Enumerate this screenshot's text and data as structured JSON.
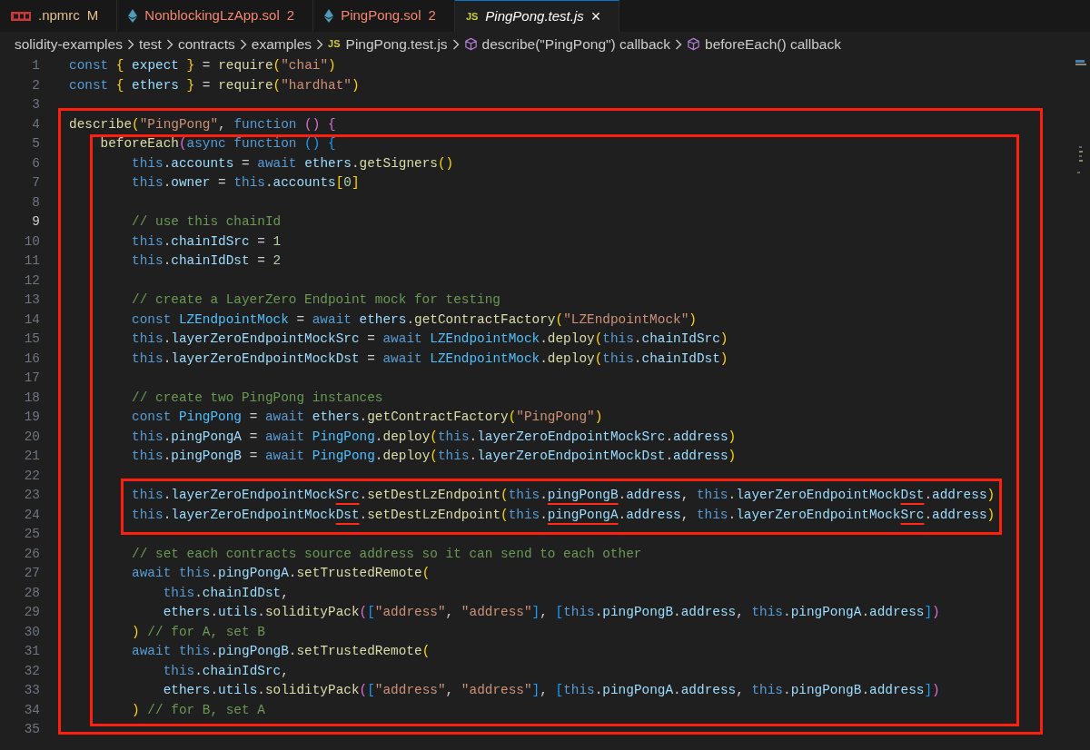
{
  "tabs": [
    {
      "label": ".npmrc",
      "badge": "M",
      "kind": "npm",
      "color": "#e2c08d",
      "selected": false,
      "preview": false
    },
    {
      "label": "NonblockingLzApp.sol",
      "badge": "2",
      "kind": "solidity",
      "color": "#f48771",
      "selected": false,
      "preview": false
    },
    {
      "label": "PingPong.sol",
      "badge": "2",
      "kind": "solidity",
      "color": "#f48771",
      "selected": false,
      "preview": false
    },
    {
      "label": "PingPong.test.js",
      "kind": "javascript",
      "icon_text": "JS",
      "color": "#ffffff",
      "selected": true,
      "preview": true,
      "close": "×"
    }
  ],
  "breadcrumb": [
    {
      "label": "solidity-examples",
      "kind": "folder"
    },
    {
      "label": "test",
      "kind": "folder"
    },
    {
      "label": "contracts",
      "kind": "folder"
    },
    {
      "label": "examples",
      "kind": "folder"
    },
    {
      "label": "PingPong.test.js",
      "kind": "javascript",
      "icon_text": "JS"
    },
    {
      "label": "describe(\"PingPong\") callback",
      "kind": "symbol"
    },
    {
      "label": "beforeEach() callback",
      "kind": "symbol"
    }
  ],
  "editor": {
    "lines": [
      {
        "kind": "line",
        "number": "1",
        "current": false,
        "tokens": [
          {
            "text": "const ",
            "kind": "kw"
          },
          {
            "text": "{",
            "kind": "gold"
          },
          {
            "text": " expect ",
            "kind": "var"
          },
          {
            "text": "}",
            "kind": "gold"
          },
          {
            "text": " = ",
            "kind": "pun"
          },
          {
            "text": "require",
            "kind": "fn"
          },
          {
            "text": "(",
            "kind": "gold"
          },
          {
            "text": "\"chai\"",
            "kind": "str"
          },
          {
            "text": ")",
            "kind": "gold"
          }
        ]
      },
      {
        "kind": "line",
        "number": "2",
        "current": false,
        "tokens": [
          {
            "text": "const ",
            "kind": "kw"
          },
          {
            "text": "{",
            "kind": "gold"
          },
          {
            "text": " ethers ",
            "kind": "var"
          },
          {
            "text": "}",
            "kind": "gold"
          },
          {
            "text": " = ",
            "kind": "pun"
          },
          {
            "text": "require",
            "kind": "fn"
          },
          {
            "text": "(",
            "kind": "gold"
          },
          {
            "text": "\"hardhat\"",
            "kind": "str"
          },
          {
            "text": ")",
            "kind": "gold"
          }
        ]
      },
      {
        "kind": "line",
        "number": "3",
        "current": false
      },
      {
        "kind": "box",
        "children": [
          {
            "kind": "line",
            "number": "4",
            "current": false,
            "tokens": [
              {
                "text": "describe",
                "kind": "fn"
              },
              {
                "text": "(",
                "kind": "gold"
              },
              {
                "text": "\"PingPong\"",
                "kind": "str"
              },
              {
                "text": ", ",
                "kind": "pun"
              },
              {
                "text": "function ",
                "kind": "kw"
              },
              {
                "text": "() ",
                "kind": "pink"
              },
              {
                "text": "{",
                "kind": "pink"
              }
            ]
          },
          {
            "kind": "box",
            "children": [
              {
                "kind": "line",
                "number": "5",
                "current": false,
                "tokens": [
                  {
                    "text": "    beforeEach",
                    "kind": "fn"
                  },
                  {
                    "text": "(",
                    "kind": "pink"
                  },
                  {
                    "text": "async function ",
                    "kind": "kw"
                  },
                  {
                    "text": "() ",
                    "kind": "blue"
                  },
                  {
                    "text": "{",
                    "kind": "blue"
                  }
                ]
              },
              {
                "kind": "line",
                "number": "6",
                "current": false,
                "tokens": [
                  {
                    "text": "        this",
                    "kind": "kw"
                  },
                  {
                    "text": ".",
                    "kind": "pun"
                  },
                  {
                    "text": "accounts",
                    "kind": "var"
                  },
                  {
                    "text": " = ",
                    "kind": "pun"
                  },
                  {
                    "text": "await ",
                    "kind": "kw"
                  },
                  {
                    "text": "ethers",
                    "kind": "var"
                  },
                  {
                    "text": ".",
                    "kind": "pun"
                  },
                  {
                    "text": "getSigners",
                    "kind": "fn"
                  },
                  {
                    "text": "()",
                    "kind": "gold"
                  }
                ]
              },
              {
                "kind": "line",
                "number": "7",
                "current": false,
                "tokens": [
                  {
                    "text": "        this",
                    "kind": "kw"
                  },
                  {
                    "text": ".",
                    "kind": "pun"
                  },
                  {
                    "text": "owner",
                    "kind": "var"
                  },
                  {
                    "text": " = ",
                    "kind": "pun"
                  },
                  {
                    "text": "this",
                    "kind": "kw"
                  },
                  {
                    "text": ".",
                    "kind": "pun"
                  },
                  {
                    "text": "accounts",
                    "kind": "var"
                  },
                  {
                    "text": "[",
                    "kind": "gold"
                  },
                  {
                    "text": "0",
                    "kind": "num"
                  },
                  {
                    "text": "]",
                    "kind": "gold"
                  }
                ]
              },
              {
                "kind": "line",
                "number": "8",
                "current": false
              },
              {
                "kind": "line",
                "number": "9",
                "current": true,
                "tokens": [
                  {
                    "text": "        // use this chainId",
                    "kind": "com"
                  }
                ]
              },
              {
                "kind": "line",
                "number": "10",
                "current": false,
                "tokens": [
                  {
                    "text": "        this",
                    "kind": "kw"
                  },
                  {
                    "text": ".",
                    "kind": "pun"
                  },
                  {
                    "text": "chainIdSrc",
                    "kind": "var"
                  },
                  {
                    "text": " = ",
                    "kind": "pun"
                  },
                  {
                    "text": "1",
                    "kind": "num"
                  }
                ]
              },
              {
                "kind": "line",
                "number": "11",
                "current": false,
                "tokens": [
                  {
                    "text": "        this",
                    "kind": "kw"
                  },
                  {
                    "text": ".",
                    "kind": "pun"
                  },
                  {
                    "text": "chainIdDst",
                    "kind": "var"
                  },
                  {
                    "text": " = ",
                    "kind": "pun"
                  },
                  {
                    "text": "2",
                    "kind": "num"
                  }
                ]
              },
              {
                "kind": "line",
                "number": "12",
                "current": false
              },
              {
                "kind": "line",
                "number": "13",
                "current": false,
                "tokens": [
                  {
                    "text": "        // create a LayerZero Endpoint mock for testing",
                    "kind": "com"
                  }
                ]
              },
              {
                "kind": "line",
                "number": "14",
                "current": false,
                "tokens": [
                  {
                    "text": "        const ",
                    "kind": "kw"
                  },
                  {
                    "text": "LZEndpointMock",
                    "kind": "const"
                  },
                  {
                    "text": " = ",
                    "kind": "pun"
                  },
                  {
                    "text": "await ",
                    "kind": "kw"
                  },
                  {
                    "text": "ethers",
                    "kind": "var"
                  },
                  {
                    "text": ".",
                    "kind": "pun"
                  },
                  {
                    "text": "getContractFactory",
                    "kind": "fn"
                  },
                  {
                    "text": "(",
                    "kind": "gold"
                  },
                  {
                    "text": "\"LZEndpointMock\"",
                    "kind": "str"
                  },
                  {
                    "text": ")",
                    "kind": "gold"
                  }
                ]
              },
              {
                "kind": "line",
                "number": "15",
                "current": false,
                "tokens": [
                  {
                    "text": "        this",
                    "kind": "kw"
                  },
                  {
                    "text": ".",
                    "kind": "pun"
                  },
                  {
                    "text": "layerZeroEndpointMockSrc",
                    "kind": "var"
                  },
                  {
                    "text": " = ",
                    "kind": "pun"
                  },
                  {
                    "text": "await ",
                    "kind": "kw"
                  },
                  {
                    "text": "LZEndpointMock",
                    "kind": "const"
                  },
                  {
                    "text": ".",
                    "kind": "pun"
                  },
                  {
                    "text": "deploy",
                    "kind": "fn"
                  },
                  {
                    "text": "(",
                    "kind": "gold"
                  },
                  {
                    "text": "this",
                    "kind": "kw"
                  },
                  {
                    "text": ".",
                    "kind": "pun"
                  },
                  {
                    "text": "chainIdSrc",
                    "kind": "var"
                  },
                  {
                    "text": ")",
                    "kind": "gold"
                  }
                ]
              },
              {
                "kind": "line",
                "number": "16",
                "current": false,
                "tokens": [
                  {
                    "text": "        this",
                    "kind": "kw"
                  },
                  {
                    "text": ".",
                    "kind": "pun"
                  },
                  {
                    "text": "layerZeroEndpointMockDst",
                    "kind": "var"
                  },
                  {
                    "text": " = ",
                    "kind": "pun"
                  },
                  {
                    "text": "await ",
                    "kind": "kw"
                  },
                  {
                    "text": "LZEndpointMock",
                    "kind": "const"
                  },
                  {
                    "text": ".",
                    "kind": "pun"
                  },
                  {
                    "text": "deploy",
                    "kind": "fn"
                  },
                  {
                    "text": "(",
                    "kind": "gold"
                  },
                  {
                    "text": "this",
                    "kind": "kw"
                  },
                  {
                    "text": ".",
                    "kind": "pun"
                  },
                  {
                    "text": "chainIdDst",
                    "kind": "var"
                  },
                  {
                    "text": ")",
                    "kind": "gold"
                  }
                ]
              },
              {
                "kind": "line",
                "number": "17",
                "current": false
              },
              {
                "kind": "line",
                "number": "18",
                "current": false,
                "tokens": [
                  {
                    "text": "        // create two PingPong instances",
                    "kind": "com"
                  }
                ]
              },
              {
                "kind": "line",
                "number": "19",
                "current": false,
                "tokens": [
                  {
                    "text": "        const ",
                    "kind": "kw"
                  },
                  {
                    "text": "PingPong",
                    "kind": "const"
                  },
                  {
                    "text": " = ",
                    "kind": "pun"
                  },
                  {
                    "text": "await ",
                    "kind": "kw"
                  },
                  {
                    "text": "ethers",
                    "kind": "var"
                  },
                  {
                    "text": ".",
                    "kind": "pun"
                  },
                  {
                    "text": "getContractFactory",
                    "kind": "fn"
                  },
                  {
                    "text": "(",
                    "kind": "gold"
                  },
                  {
                    "text": "\"PingPong\"",
                    "kind": "str"
                  },
                  {
                    "text": ")",
                    "kind": "gold"
                  }
                ]
              },
              {
                "kind": "line",
                "number": "20",
                "current": false,
                "tokens": [
                  {
                    "text": "        this",
                    "kind": "kw"
                  },
                  {
                    "text": ".",
                    "kind": "pun"
                  },
                  {
                    "text": "pingPongA",
                    "kind": "var"
                  },
                  {
                    "text": " = ",
                    "kind": "pun"
                  },
                  {
                    "text": "await ",
                    "kind": "kw"
                  },
                  {
                    "text": "PingPong",
                    "kind": "const"
                  },
                  {
                    "text": ".",
                    "kind": "pun"
                  },
                  {
                    "text": "deploy",
                    "kind": "fn"
                  },
                  {
                    "text": "(",
                    "kind": "gold"
                  },
                  {
                    "text": "this",
                    "kind": "kw"
                  },
                  {
                    "text": ".",
                    "kind": "pun"
                  },
                  {
                    "text": "layerZeroEndpointMockSrc",
                    "kind": "var"
                  },
                  {
                    "text": ".",
                    "kind": "pun"
                  },
                  {
                    "text": "address",
                    "kind": "var"
                  },
                  {
                    "text": ")",
                    "kind": "gold"
                  }
                ]
              },
              {
                "kind": "line",
                "number": "21",
                "current": false,
                "tokens": [
                  {
                    "text": "        this",
                    "kind": "kw"
                  },
                  {
                    "text": ".",
                    "kind": "pun"
                  },
                  {
                    "text": "pingPongB",
                    "kind": "var"
                  },
                  {
                    "text": " = ",
                    "kind": "pun"
                  },
                  {
                    "text": "await ",
                    "kind": "kw"
                  },
                  {
                    "text": "PingPong",
                    "kind": "const"
                  },
                  {
                    "text": ".",
                    "kind": "pun"
                  },
                  {
                    "text": "deploy",
                    "kind": "fn"
                  },
                  {
                    "text": "(",
                    "kind": "gold"
                  },
                  {
                    "text": "this",
                    "kind": "kw"
                  },
                  {
                    "text": ".",
                    "kind": "pun"
                  },
                  {
                    "text": "layerZeroEndpointMockDst",
                    "kind": "var"
                  },
                  {
                    "text": ".",
                    "kind": "pun"
                  },
                  {
                    "text": "address",
                    "kind": "var"
                  },
                  {
                    "text": ")",
                    "kind": "gold"
                  }
                ]
              },
              {
                "kind": "line",
                "number": "22",
                "current": false
              },
              {
                "kind": "box",
                "children": [
                  {
                    "kind": "line",
                    "number": "23",
                    "current": false,
                    "tokens": [
                      {
                        "text": "        this",
                        "kind": "kw"
                      },
                      {
                        "text": ".",
                        "kind": "pun"
                      },
                      {
                        "text": "layerZeroEndpointMock",
                        "kind": "var"
                      },
                      {
                        "text": "Src",
                        "kind": "marked"
                      },
                      {
                        "text": ".",
                        "kind": "pun"
                      },
                      {
                        "text": "setDestLzEndpoint",
                        "kind": "fn"
                      },
                      {
                        "text": "(",
                        "kind": "gold"
                      },
                      {
                        "text": "this",
                        "kind": "kw"
                      },
                      {
                        "text": ".",
                        "kind": "pun"
                      },
                      {
                        "text": "pingPongB",
                        "kind": "marked"
                      },
                      {
                        "text": ".",
                        "kind": "pun"
                      },
                      {
                        "text": "address",
                        "kind": "var"
                      },
                      {
                        "text": ", ",
                        "kind": "pun"
                      },
                      {
                        "text": "this",
                        "kind": "kw"
                      },
                      {
                        "text": ".",
                        "kind": "pun"
                      },
                      {
                        "text": "layerZeroEndpointMock",
                        "kind": "var"
                      },
                      {
                        "text": "Dst",
                        "kind": "marked"
                      },
                      {
                        "text": ".",
                        "kind": "pun"
                      },
                      {
                        "text": "address",
                        "kind": "var"
                      },
                      {
                        "text": ")",
                        "kind": "gold"
                      }
                    ]
                  },
                  {
                    "kind": "line",
                    "number": "24",
                    "current": false,
                    "tokens": [
                      {
                        "text": "        this",
                        "kind": "kw"
                      },
                      {
                        "text": ".",
                        "kind": "pun"
                      },
                      {
                        "text": "layerZeroEndpointMock",
                        "kind": "var"
                      },
                      {
                        "text": "Dst",
                        "kind": "marked"
                      },
                      {
                        "text": ".",
                        "kind": "pun"
                      },
                      {
                        "text": "setDestLzEndpoint",
                        "kind": "fn"
                      },
                      {
                        "text": "(",
                        "kind": "gold"
                      },
                      {
                        "text": "this",
                        "kind": "kw"
                      },
                      {
                        "text": ".",
                        "kind": "pun"
                      },
                      {
                        "text": "pingPongA",
                        "kind": "marked"
                      },
                      {
                        "text": ".",
                        "kind": "pun"
                      },
                      {
                        "text": "address",
                        "kind": "var"
                      },
                      {
                        "text": ", ",
                        "kind": "pun"
                      },
                      {
                        "text": "this",
                        "kind": "kw"
                      },
                      {
                        "text": ".",
                        "kind": "pun"
                      },
                      {
                        "text": "layerZeroEndpointMock",
                        "kind": "var"
                      },
                      {
                        "text": "Src",
                        "kind": "marked"
                      },
                      {
                        "text": ".",
                        "kind": "pun"
                      },
                      {
                        "text": "address",
                        "kind": "var"
                      },
                      {
                        "text": ")",
                        "kind": "gold"
                      }
                    ]
                  }
                ]
              },
              {
                "kind": "line",
                "number": "25",
                "current": false
              },
              {
                "kind": "line",
                "number": "26",
                "current": false,
                "tokens": [
                  {
                    "text": "        // set each contracts source address so it can send to each other",
                    "kind": "com"
                  }
                ]
              },
              {
                "kind": "line",
                "number": "27",
                "current": false,
                "tokens": [
                  {
                    "text": "        await ",
                    "kind": "kw"
                  },
                  {
                    "text": "this",
                    "kind": "kw"
                  },
                  {
                    "text": ".",
                    "kind": "pun"
                  },
                  {
                    "text": "pingPongA",
                    "kind": "var"
                  },
                  {
                    "text": ".",
                    "kind": "pun"
                  },
                  {
                    "text": "setTrustedRemote",
                    "kind": "fn"
                  },
                  {
                    "text": "(",
                    "kind": "gold"
                  }
                ]
              },
              {
                "kind": "line",
                "number": "28",
                "current": false,
                "tokens": [
                  {
                    "text": "            this",
                    "kind": "kw"
                  },
                  {
                    "text": ".",
                    "kind": "pun"
                  },
                  {
                    "text": "chainIdDst",
                    "kind": "var"
                  },
                  {
                    "text": ",",
                    "kind": "pun"
                  }
                ]
              },
              {
                "kind": "line",
                "number": "29",
                "current": false,
                "tokens": [
                  {
                    "text": "            ethers",
                    "kind": "var"
                  },
                  {
                    "text": ".",
                    "kind": "pun"
                  },
                  {
                    "text": "utils",
                    "kind": "var"
                  },
                  {
                    "text": ".",
                    "kind": "pun"
                  },
                  {
                    "text": "solidityPack",
                    "kind": "fn"
                  },
                  {
                    "text": "(",
                    "kind": "pink"
                  },
                  {
                    "text": "[",
                    "kind": "blue"
                  },
                  {
                    "text": "\"address\"",
                    "kind": "str"
                  },
                  {
                    "text": ", ",
                    "kind": "pun"
                  },
                  {
                    "text": "\"address\"",
                    "kind": "str"
                  },
                  {
                    "text": "]",
                    "kind": "blue"
                  },
                  {
                    "text": ", ",
                    "kind": "pun"
                  },
                  {
                    "text": "[",
                    "kind": "blue"
                  },
                  {
                    "text": "this",
                    "kind": "kw"
                  },
                  {
                    "text": ".",
                    "kind": "pun"
                  },
                  {
                    "text": "pingPongB",
                    "kind": "var"
                  },
                  {
                    "text": ".",
                    "kind": "pun"
                  },
                  {
                    "text": "address",
                    "kind": "var"
                  },
                  {
                    "text": ", ",
                    "kind": "pun"
                  },
                  {
                    "text": "this",
                    "kind": "kw"
                  },
                  {
                    "text": ".",
                    "kind": "pun"
                  },
                  {
                    "text": "pingPongA",
                    "kind": "var"
                  },
                  {
                    "text": ".",
                    "kind": "pun"
                  },
                  {
                    "text": "address",
                    "kind": "var"
                  },
                  {
                    "text": "]",
                    "kind": "blue"
                  },
                  {
                    "text": ")",
                    "kind": "pink"
                  }
                ]
              },
              {
                "kind": "line",
                "number": "30",
                "current": false,
                "tokens": [
                  {
                    "text": "        )",
                    "kind": "gold"
                  },
                  {
                    "text": " // for A, set B",
                    "kind": "com"
                  }
                ]
              },
              {
                "kind": "line",
                "number": "31",
                "current": false,
                "tokens": [
                  {
                    "text": "        await ",
                    "kind": "kw"
                  },
                  {
                    "text": "this",
                    "kind": "kw"
                  },
                  {
                    "text": ".",
                    "kind": "pun"
                  },
                  {
                    "text": "pingPongB",
                    "kind": "var"
                  },
                  {
                    "text": ".",
                    "kind": "pun"
                  },
                  {
                    "text": "setTrustedRemote",
                    "kind": "fn"
                  },
                  {
                    "text": "(",
                    "kind": "gold"
                  }
                ]
              },
              {
                "kind": "line",
                "number": "32",
                "current": false,
                "tokens": [
                  {
                    "text": "            this",
                    "kind": "kw"
                  },
                  {
                    "text": ".",
                    "kind": "pun"
                  },
                  {
                    "text": "chainIdSrc",
                    "kind": "var"
                  },
                  {
                    "text": ",",
                    "kind": "pun"
                  }
                ]
              },
              {
                "kind": "line",
                "number": "33",
                "current": false,
                "tokens": [
                  {
                    "text": "            ethers",
                    "kind": "var"
                  },
                  {
                    "text": ".",
                    "kind": "pun"
                  },
                  {
                    "text": "utils",
                    "kind": "var"
                  },
                  {
                    "text": ".",
                    "kind": "pun"
                  },
                  {
                    "text": "solidityPack",
                    "kind": "fn"
                  },
                  {
                    "text": "(",
                    "kind": "pink"
                  },
                  {
                    "text": "[",
                    "kind": "blue"
                  },
                  {
                    "text": "\"address\"",
                    "kind": "str"
                  },
                  {
                    "text": ", ",
                    "kind": "pun"
                  },
                  {
                    "text": "\"address\"",
                    "kind": "str"
                  },
                  {
                    "text": "]",
                    "kind": "blue"
                  },
                  {
                    "text": ", ",
                    "kind": "pun"
                  },
                  {
                    "text": "[",
                    "kind": "blue"
                  },
                  {
                    "text": "this",
                    "kind": "kw"
                  },
                  {
                    "text": ".",
                    "kind": "pun"
                  },
                  {
                    "text": "pingPongA",
                    "kind": "var"
                  },
                  {
                    "text": ".",
                    "kind": "pun"
                  },
                  {
                    "text": "address",
                    "kind": "var"
                  },
                  {
                    "text": ", ",
                    "kind": "pun"
                  },
                  {
                    "text": "this",
                    "kind": "kw"
                  },
                  {
                    "text": ".",
                    "kind": "pun"
                  },
                  {
                    "text": "pingPongB",
                    "kind": "var"
                  },
                  {
                    "text": ".",
                    "kind": "pun"
                  },
                  {
                    "text": "address",
                    "kind": "var"
                  },
                  {
                    "text": "]",
                    "kind": "blue"
                  },
                  {
                    "text": ")",
                    "kind": "pink"
                  }
                ]
              },
              {
                "kind": "line",
                "number": "34",
                "current": false,
                "tokens": [
                  {
                    "text": "        )",
                    "kind": "gold"
                  },
                  {
                    "text": " // for B, set A",
                    "kind": "com"
                  }
                ]
              }
            ]
          },
          {
            "kind": "line",
            "number": "35",
            "current": false
          }
        ]
      }
    ]
  }
}
